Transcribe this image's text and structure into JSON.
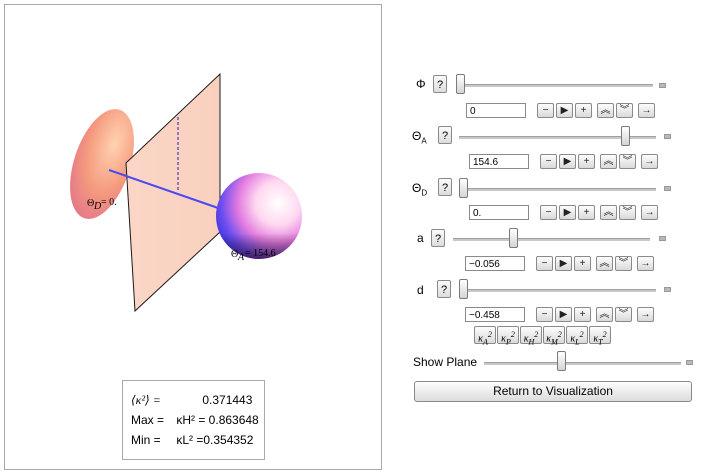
{
  "scene": {
    "label_d": "= 0.",
    "label_d_theta": "Θ",
    "label_d_sub": "D",
    "label_a": "= 154.6",
    "label_a_theta": "Θ",
    "label_a_sub": "A"
  },
  "results": {
    "mean": {
      "label": "⟨κ²⟩ =",
      "value": "0.371443"
    },
    "max": {
      "label": "Max =",
      "value": "κH² = 0.863648"
    },
    "min": {
      "label": "Min =",
      "value": "κL² =0.354352"
    }
  },
  "controls": {
    "phi": {
      "label": "Φ",
      "help": "?",
      "value": "0",
      "level": 0.0
    },
    "theta_a": {
      "label": "ΘA",
      "help": "?",
      "value": "154.6",
      "level": 0.86
    },
    "theta_d": {
      "label": "ΘD",
      "help": "?",
      "value": "0.",
      "level": 0.0
    },
    "a": {
      "label": "a",
      "help": "?",
      "value": "−0.056",
      "level": 0.3
    },
    "d": {
      "label": "d",
      "help": "?",
      "value": "−0.458",
      "level": 0.0
    }
  },
  "stepper_icons": [
    "minus-icon",
    "play-icon",
    "plus-icon",
    "faster-icon",
    "slower-icon",
    "direction-icon"
  ],
  "kappa_buttons": [
    "κA²",
    "κP²",
    "κH²",
    "κM²",
    "κL²",
    "κT²"
  ],
  "show_plane": {
    "label": "Show Plane",
    "level": 0.5
  },
  "return_button": "Return to Visualization"
}
